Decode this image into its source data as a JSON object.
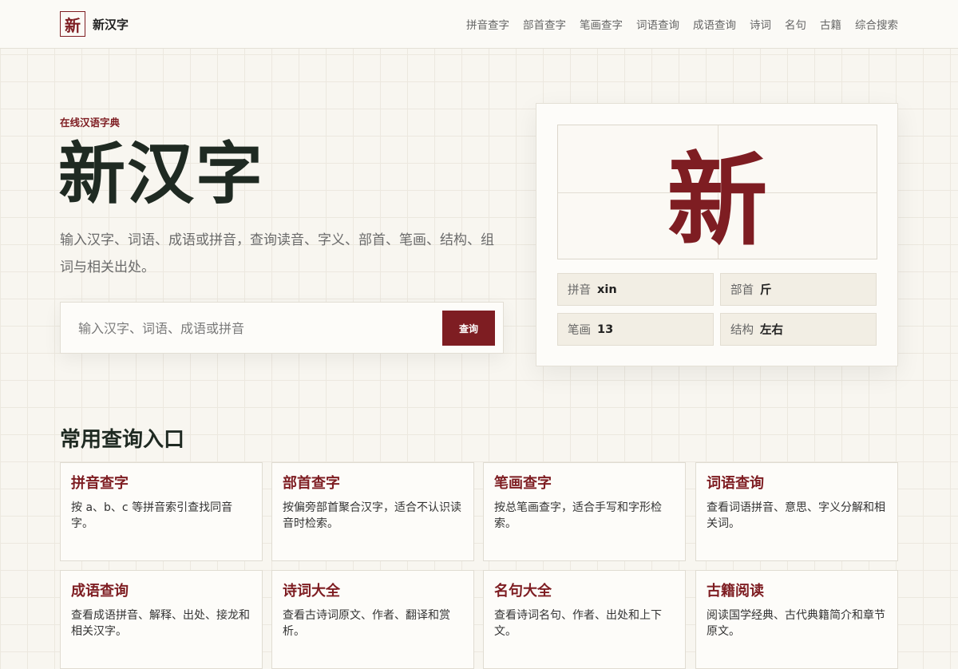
{
  "header": {
    "logo_char": "新",
    "site_name": "新汉字",
    "nav": [
      "拼音查字",
      "部首查字",
      "笔画查字",
      "词语查询",
      "成语查询",
      "诗词",
      "名句",
      "古籍",
      "综合搜索"
    ]
  },
  "hero": {
    "eyebrow": "在线汉语字典",
    "title": "新汉字",
    "description": "输入汉字、词语、成语或拼音，查询读音、字义、部首、笔画、结构、组词与相关出处。",
    "search": {
      "placeholder": "输入汉字、词语、成语或拼音",
      "value": "",
      "button_label": "查询"
    }
  },
  "char_card": {
    "char": "新",
    "attrs": [
      {
        "label": "拼音",
        "value": "xin"
      },
      {
        "label": "部首",
        "value": "斤"
      },
      {
        "label": "笔画",
        "value": "13"
      },
      {
        "label": "结构",
        "value": "左右"
      }
    ]
  },
  "section": {
    "title": "常用查询入口",
    "cards": [
      {
        "title": "拼音查字",
        "desc": "按 a、b、c 等拼音索引查找同音字。"
      },
      {
        "title": "部首查字",
        "desc": "按偏旁部首聚合汉字，适合不认识读音时检索。"
      },
      {
        "title": "笔画查字",
        "desc": "按总笔画查字，适合手写和字形检索。"
      },
      {
        "title": "词语查询",
        "desc": "查看词语拼音、意思、字义分解和相关词。"
      },
      {
        "title": "成语查询",
        "desc": "查看成语拼音、解释、出处、接龙和相关汉字。"
      },
      {
        "title": "诗词大全",
        "desc": "查看古诗词原文、作者、翻译和赏析。"
      },
      {
        "title": "名句大全",
        "desc": "查看诗词名句、作者、出处和上下文。"
      },
      {
        "title": "古籍阅读",
        "desc": "阅读国学经典、古代典籍简介和章节原文。"
      }
    ]
  },
  "colors": {
    "accent": "#7e1d22",
    "background": "#f8f6f0",
    "text_dark": "#1f2a22"
  }
}
